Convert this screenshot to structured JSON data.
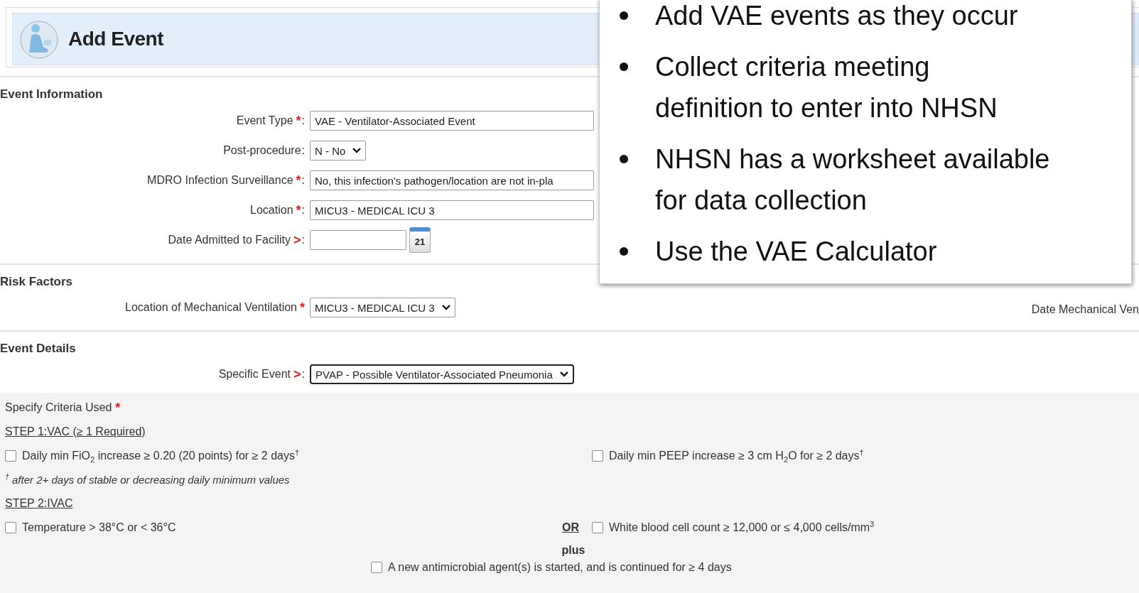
{
  "header": {
    "title": "Add Event"
  },
  "sections": [
    {
      "heading": "Event Information",
      "fields": [
        {
          "label": "Event Type",
          "marker": "*",
          "suffix": ":",
          "kind": "select",
          "value": "VAE - Ventilator-Associated Event",
          "arrow_visible": false
        },
        {
          "label": "Post-procedure",
          "suffix": ":",
          "kind": "select",
          "value": "N - No",
          "arrow_visible": true
        },
        {
          "label": "MDRO Infection Surveillance",
          "marker": "*",
          "suffix": ":",
          "kind": "select",
          "value": "No, this infection's pathogen/location are not in-pla",
          "arrow_visible": false
        },
        {
          "label": "Location",
          "marker": "*",
          "suffix": ":",
          "kind": "select",
          "value": "MICU3 - MEDICAL ICU 3",
          "arrow_visible": false
        },
        {
          "label": "Date Admitted to Facility",
          "marker": ">",
          "suffix": ":",
          "kind": "date",
          "calendar_label": "21"
        }
      ]
    },
    {
      "heading": "Risk Factors",
      "fields": [
        {
          "label": "Location of Mechanical Ventilation",
          "marker": "*",
          "kind": "select",
          "value": "MICU3 - MEDICAL ICU 3",
          "arrow_visible": true,
          "side_label": "Date Mechanical Ven"
        }
      ]
    },
    {
      "heading": "Event Details",
      "fields": [
        {
          "label": "Specific Event",
          "marker": ">",
          "suffix": ":",
          "kind": "select",
          "value": "PVAP - Possible Ventilator-Associated Pneumonia",
          "arrow_visible": true,
          "focused": true
        }
      ]
    }
  ],
  "criteria": {
    "title": "Specify Criteria Used",
    "marker": "*",
    "steps": [
      {
        "heading": "STEP 1:VAC  (≥ 1 Required)",
        "left": {
          "text": "Daily min FiO$_{2}$ increase ≥ 0.20 (20 points) for ≥ 2 days$^{†}$",
          "checked": false
        },
        "right": {
          "text": "Daily min PEEP increase ≥ 3 cm H$_{2}$O for ≥ 2 days$^{†}$",
          "checked": false
        },
        "note": "$^{†}$ after 2+ days of stable or decreasing daily minimum values"
      },
      {
        "heading": "STEP 2:IVAC",
        "left": {
          "text": "Temperature > 38°C or < 36°C",
          "checked": false
        },
        "connector": "OR",
        "right": {
          "text": "White blood cell count ≥ 12,000 or ≤ 4,000 cells/mm$^{3}$",
          "checked": false
        },
        "joiner": "plus",
        "extra": {
          "text": "A new antimicrobial agent(s) is started, and is continued for ≥ 4 days",
          "checked": false
        }
      }
    ]
  },
  "callout": {
    "bullets": [
      "Add VAE events as they occur",
      "Collect criteria meeting\ndefinition to enter into NHSN",
      "NHSN has a worksheet available\nfor data collection",
      "Use the VAE Calculator"
    ]
  }
}
